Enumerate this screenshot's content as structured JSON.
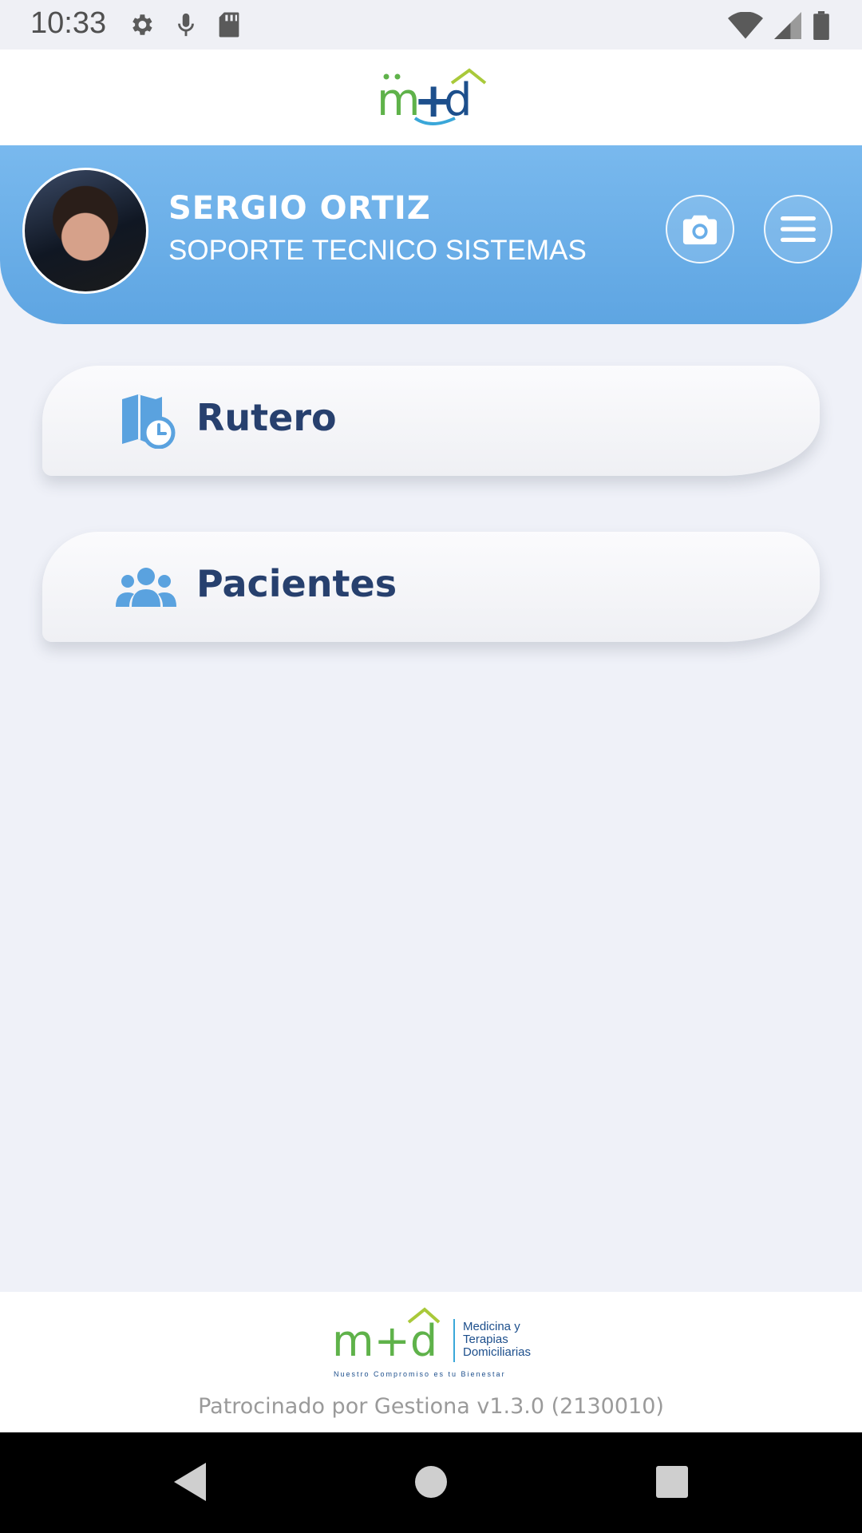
{
  "status_bar": {
    "time": "10:33",
    "icons_left": [
      "gear-icon",
      "mic-icon",
      "sd-card-icon"
    ],
    "icons_right": [
      "wifi-icon",
      "signal-icon",
      "battery-icon"
    ]
  },
  "header": {
    "logo": "m+d-logo"
  },
  "profile": {
    "name": "SERGIO ORTIZ",
    "role": "SOPORTE TECNICO SISTEMAS",
    "camera_icon": "camera-icon",
    "menu_icon": "hamburger-menu-icon"
  },
  "menu": {
    "items": [
      {
        "label": "Rutero",
        "icon": "map-clock-icon"
      },
      {
        "label": "Pacientes",
        "icon": "users-group-icon"
      }
    ]
  },
  "footer": {
    "logo_brand": "m+d",
    "logo_line1": "Medicina y",
    "logo_line2": "Terapias",
    "logo_line3": "Domiciliarias",
    "logo_tagline": "Nuestro Compromiso es tu Bienestar",
    "sponsor_text": "Patrocinado por Gestiona v1.3.0 (2130010)"
  },
  "nav": {
    "back_icon": "back-triangle-icon",
    "home_icon": "home-circle-icon",
    "recents_icon": "recents-square-icon"
  },
  "colors": {
    "banner": "#6aaee8",
    "accent_blue": "#5aa2df",
    "navy_text": "#27406e",
    "logo_green": "#5fb24a",
    "logo_blue": "#1d4f8c"
  }
}
